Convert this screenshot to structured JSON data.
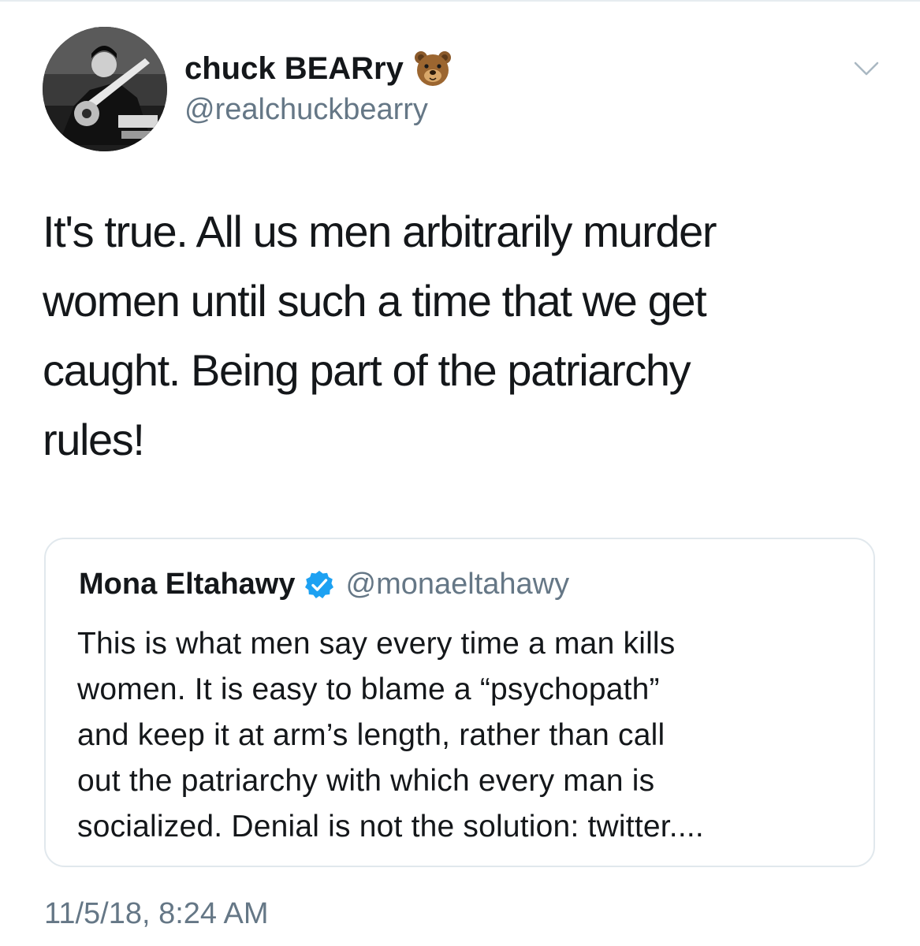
{
  "tweet": {
    "author": {
      "display_name": "chuck BEARry",
      "emoji": "bear-face",
      "handle": "@realchuckbearry",
      "avatar": "guitarist-photo"
    },
    "menu_icon": "chevron-down-icon",
    "text_lines": [
      "It's true. All us men arbitrarily murder",
      "women until such a time that we get",
      "caught. Being part of the patriarchy",
      "rules!"
    ],
    "timestamp": "11/5/18, 8:24 AM"
  },
  "quoted_tweet": {
    "author_name": "Mona Eltahawy",
    "verified": true,
    "handle": "@monaeltahawy",
    "text_lines": [
      "This is what men say every time a man kills",
      "women. It is easy to blame a “psychopath”",
      "and keep it at arm’s length, rather than call",
      "out the patriarchy with which every man is",
      "socialized. Denial is not the solution: twitter...."
    ]
  },
  "colors": {
    "text_primary": "#14171a",
    "text_secondary": "#657786",
    "border": "#e1e8ed",
    "verified_blue": "#1da1f2"
  }
}
